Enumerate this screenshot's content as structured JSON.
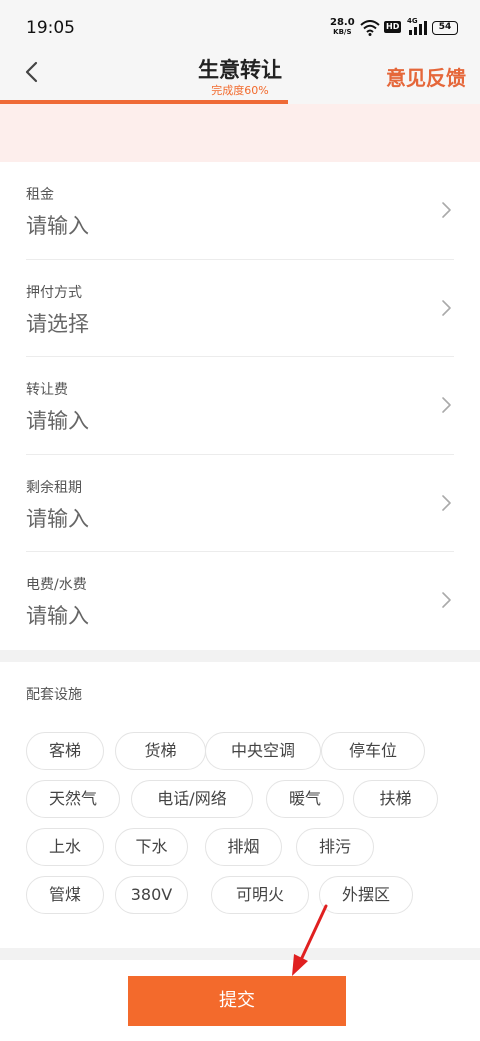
{
  "status_bar": {
    "time": "19:05",
    "net_speed": "28.0",
    "net_speed_unit": "KB/S",
    "hd_badge": "HD",
    "network_type": "4G",
    "battery": "54"
  },
  "header": {
    "title": "生意转让",
    "progress_text": "完成度60%",
    "progress_value": 0.6,
    "feedback_label": "意见反馈"
  },
  "form": {
    "fields": [
      {
        "label": "租金",
        "value": "请输入"
      },
      {
        "label": "押付方式",
        "value": "请选择"
      },
      {
        "label": "转让费",
        "value": "请输入"
      },
      {
        "label": "剩余租期",
        "value": "请输入"
      },
      {
        "label": "电费/水费",
        "value": "请输入"
      }
    ]
  },
  "facilities": {
    "heading": "配套设施",
    "tags": [
      "客梯",
      "货梯",
      "中央空调",
      "停车位",
      "天然气",
      "电话/网络",
      "暖气",
      "扶梯",
      "上水",
      "下水",
      "排烟",
      "排污",
      "管煤",
      "380V",
      "可明火",
      "外摆区"
    ]
  },
  "footer": {
    "submit_label": "提交"
  },
  "colors": {
    "accent": "#f36a2c",
    "annotation_arrow": "#e02020"
  },
  "icons": {
    "back": "chevron-left-icon",
    "row_chevron": "chevron-right-icon",
    "annotation": "red-arrow-icon"
  }
}
